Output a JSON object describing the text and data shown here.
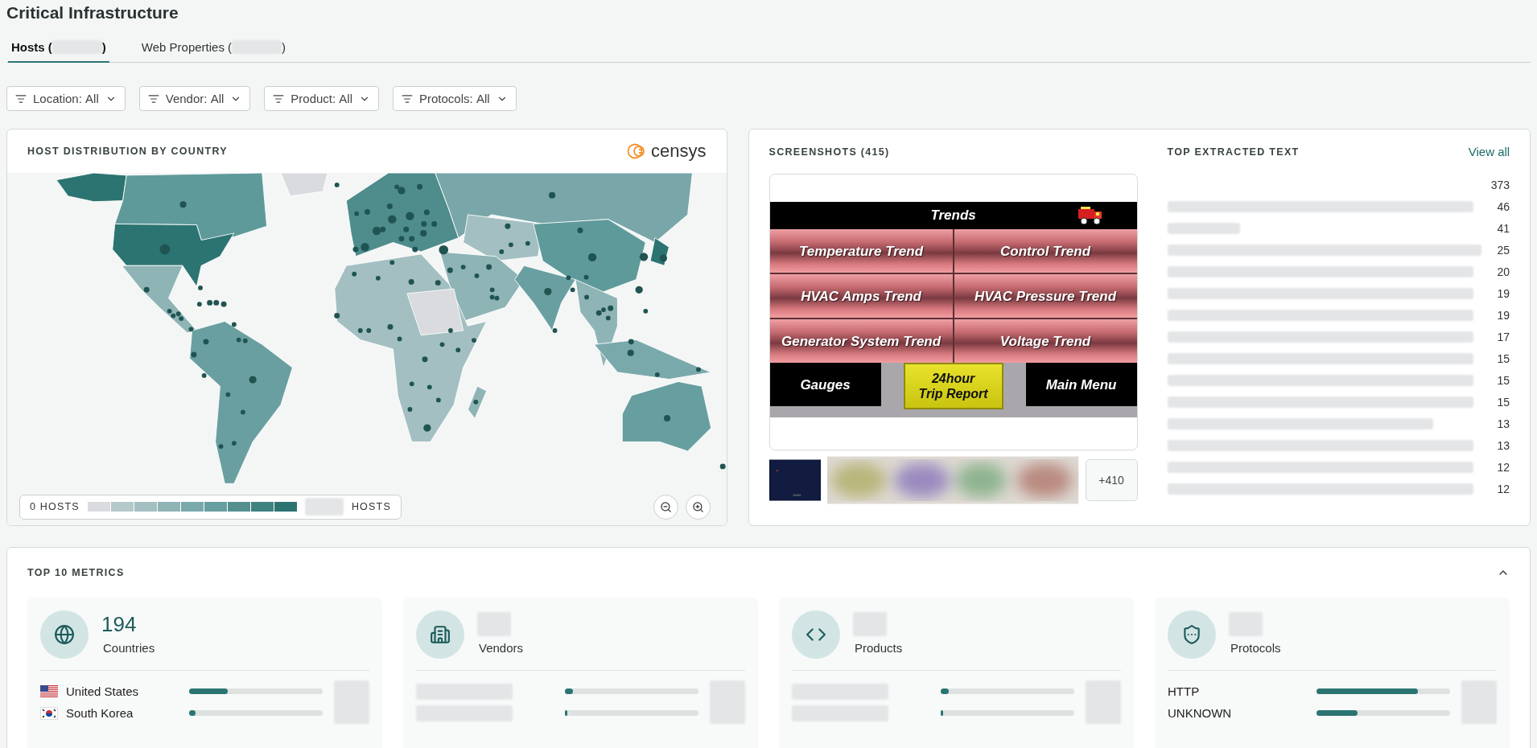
{
  "page": {
    "title": "Critical Infrastructure"
  },
  "tabs": [
    {
      "label": "Hosts (",
      "end": ")",
      "selected": true
    },
    {
      "label": "Web Properties (",
      "end": ")",
      "selected": false
    }
  ],
  "filters": [
    {
      "label": "Location:",
      "value": "All"
    },
    {
      "label": "Vendor:",
      "value": "All"
    },
    {
      "label": "Product:",
      "value": "All"
    },
    {
      "label": "Protocols:",
      "value": "All"
    }
  ],
  "map_card": {
    "title": "HOST DISTRIBUTION BY COUNTRY",
    "logo": "censys",
    "legend": {
      "min_label": "0 HOSTS",
      "max_label": "HOSTS",
      "swatches": [
        {
          "color": "#d9dbdf"
        },
        {
          "color": "#b5c8ca"
        },
        {
          "color": "#a3bfc1"
        },
        {
          "color": "#8fb4b6"
        },
        {
          "color": "#7aa9ab"
        },
        {
          "color": "#679e9f"
        },
        {
          "color": "#55908f"
        },
        {
          "color": "#3f8381"
        },
        {
          "color": "#2b7472"
        }
      ]
    }
  },
  "screenshots": {
    "title": "SCREENSHOTS (415)",
    "preview": {
      "header": "Trends",
      "buttons": [
        {
          "label": "Temperature Trend",
          "kind": "trend"
        },
        {
          "label": "Control Trend",
          "kind": "trend"
        },
        {
          "label": "HVAC Amps Trend",
          "kind": "trend"
        },
        {
          "label": "HVAC Pressure Trend",
          "kind": "trend"
        },
        {
          "label": "Generator System Trend",
          "kind": "trend"
        },
        {
          "label": "Voltage Trend",
          "kind": "trend"
        },
        {
          "label": "Gauges",
          "kind": "nav"
        },
        {
          "label": "24hour\nTrip Report",
          "kind": "highlight"
        },
        {
          "label": "Main Menu",
          "kind": "nav"
        }
      ]
    },
    "more": "+410"
  },
  "extracted_text": {
    "title": "TOP EXTRACTED TEXT",
    "link": "View all",
    "rows": [
      {
        "count": "373",
        "blurred": false
      },
      {
        "count": "46",
        "blurred": true
      },
      {
        "count": "41",
        "blurred": true
      },
      {
        "count": "25",
        "blurred": true
      },
      {
        "count": "20",
        "blurred": true
      },
      {
        "count": "19",
        "blurred": true
      },
      {
        "count": "19",
        "blurred": true
      },
      {
        "count": "17",
        "blurred": true
      },
      {
        "count": "15",
        "blurred": true
      },
      {
        "count": "15",
        "blurred": true
      },
      {
        "count": "15",
        "blurred": true
      },
      {
        "count": "13",
        "blurred": true
      },
      {
        "count": "13",
        "blurred": true
      },
      {
        "count": "12",
        "blurred": true
      },
      {
        "count": "12",
        "blurred": true
      }
    ]
  },
  "metrics": {
    "title": "TOP 10 METRICS",
    "expanded": true,
    "cards": [
      {
        "value": "194",
        "label": "Countries",
        "rows": [
          {
            "name": "United States",
            "level": 0.29
          },
          {
            "name": "South Korea",
            "level": 0.05
          }
        ]
      },
      {
        "label": "Vendors",
        "rows": [
          {
            "level": 0.06
          },
          {
            "level": 0.02
          }
        ]
      },
      {
        "label": "Products",
        "rows": [
          {
            "level": 0.06
          },
          {
            "level": 0.02
          }
        ]
      },
      {
        "label": "Protocols",
        "rows": [
          {
            "name": "HTTP",
            "level": 0.76
          },
          {
            "name": "UNKNOWN",
            "level": 0.31
          }
        ]
      }
    ]
  }
}
